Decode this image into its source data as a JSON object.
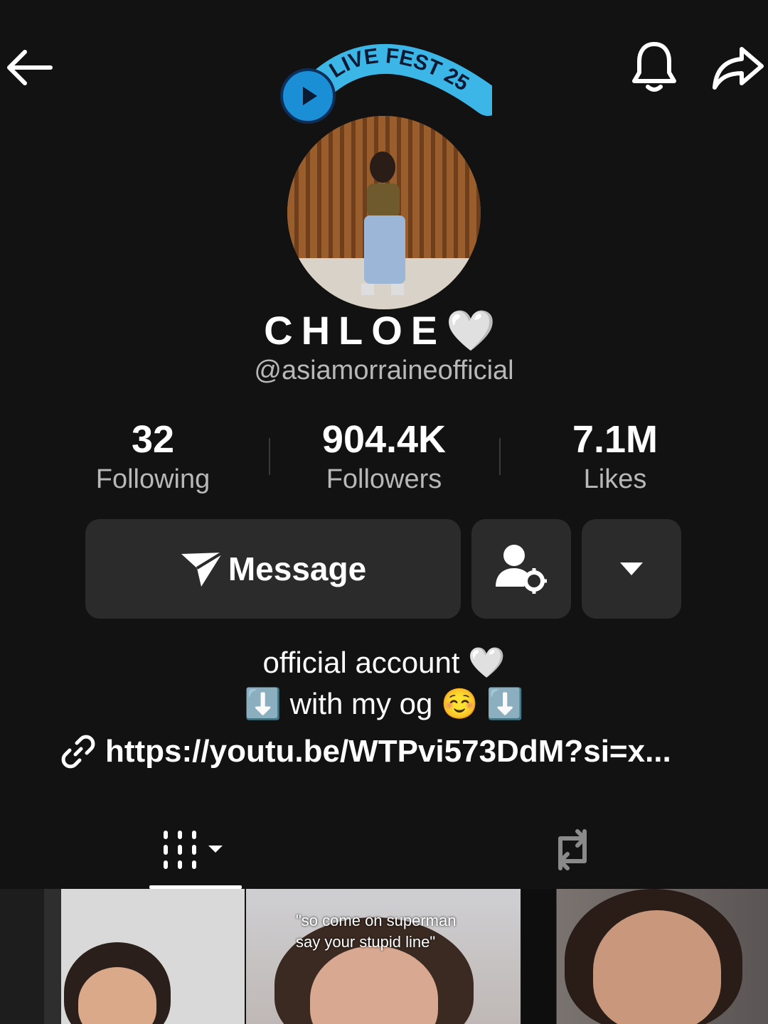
{
  "header": {
    "back_icon": "arrow-left-icon",
    "notifications_icon": "bell-icon",
    "share_icon": "share-arrow-icon"
  },
  "avatar": {
    "badge_text": "LIVE FEST 25"
  },
  "profile": {
    "display_name": "CHLOE🤍",
    "username": "@asiamorraineofficial"
  },
  "stats": [
    {
      "value": "32",
      "label": "Following"
    },
    {
      "value": "904.4K",
      "label": "Followers"
    },
    {
      "value": "7.1M",
      "label": "Likes"
    }
  ],
  "actions": {
    "message_label": "Message",
    "message_icon": "send-icon",
    "friend_icon": "user-settings-icon",
    "more_icon": "caret-down-icon"
  },
  "bio": {
    "line1": "official account 🤍",
    "line2": "⬇️ with my og ☺️ ⬇️",
    "link": "https://youtu.be/WTPvi573DdM?si=x..."
  },
  "tabs": {
    "videos_icon": "grid-icon",
    "reposts_icon": "repost-icon"
  },
  "videos": [
    {
      "caption": ""
    },
    {
      "caption": "\"so come on superman\nsay your stupid line\""
    },
    {
      "caption": ""
    }
  ]
}
